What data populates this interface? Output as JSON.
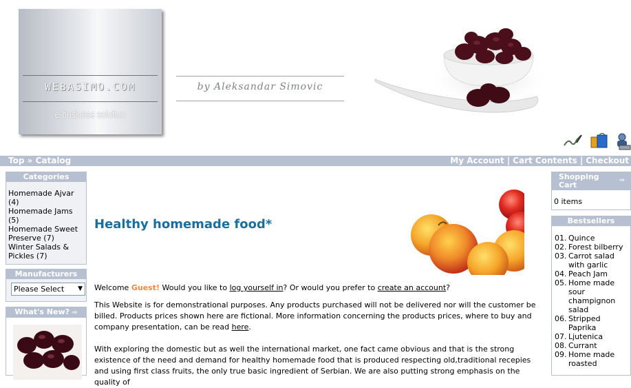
{
  "header": {
    "site_name": "WEBASIMO.COM",
    "tagline": "e-business solution",
    "author": "by Aleksandar Simovic"
  },
  "navbar": {
    "breadcrumb_top": "Top",
    "breadcrumb_sep": "»",
    "breadcrumb_catalog": "Catalog",
    "my_account": "My Account",
    "cart_contents": "Cart Contents",
    "checkout": "Checkout",
    "separator": "|"
  },
  "left": {
    "categories": {
      "title": "Categories",
      "items": [
        {
          "label": "Homemade Ajvar (4)"
        },
        {
          "label": "Homemade Jams (5)"
        },
        {
          "label": "Homemade Sweet Preserve (7)"
        },
        {
          "label": "Winter Salads & Pickles (7)"
        }
      ]
    },
    "manufacturers": {
      "title": "Manufacturers",
      "select_value": "Please Select"
    },
    "whats_new": {
      "title": "What's New?"
    }
  },
  "right": {
    "cart": {
      "title": "Shopping Cart",
      "items_text": "0 items"
    },
    "bestsellers": {
      "title": "Bestsellers",
      "items": [
        {
          "num": "01.",
          "label": "Quince"
        },
        {
          "num": "02.",
          "label": "Forest bilberry"
        },
        {
          "num": "03.",
          "label": "Carrot salad with garlic"
        },
        {
          "num": "04.",
          "label": "Peach Jam"
        },
        {
          "num": "05.",
          "label": "Home made sour champignon salad"
        },
        {
          "num": "06.",
          "label": "Stripped Paprika"
        },
        {
          "num": "07.",
          "label": "Ljutenica"
        },
        {
          "num": "08.",
          "label": "Currant"
        },
        {
          "num": "09.",
          "label": "Home made roasted"
        }
      ]
    }
  },
  "main": {
    "title": "Healthy homemade food*",
    "welcome_prefix": "Welcome ",
    "guest": "Guest!",
    "welcome_mid": " Would you like to ",
    "login_link": "log yourself in",
    "welcome_or": "? Or would you prefer to ",
    "create_link": "create an account",
    "welcome_end": "?",
    "para1": "This Website is for demonstrational purposes. Any products purchased will not be delivered nor will the customer be billed. Products prices shown here are fictional. More information concerning the products prices, where to buy and company presentation, can be read ",
    "here_link": "here",
    "para1_end": ".",
    "para2": "With exploring the domestic but as well the international market, one fact came obvious and that is the strong existence of the need and demand for healthy homemade food that is produced respecting old,traditional recepies and using first class fruits, the only true basic ingredient of Serbian. We are also putting strong emphasis on the quality of"
  }
}
